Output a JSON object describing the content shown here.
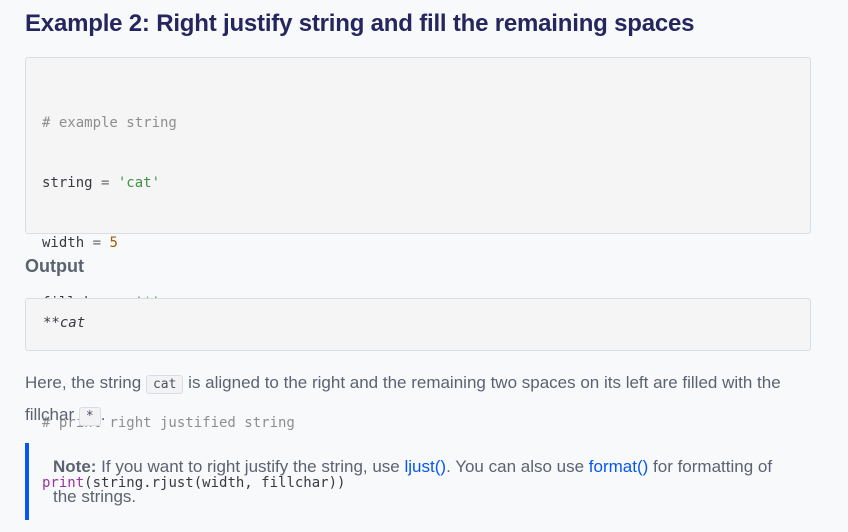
{
  "heading": "Example 2: Right justify string and fill the remaining spaces",
  "code": {
    "line1": "# example string",
    "line2_var": "string",
    "line2_op": " = ",
    "line2_val": "'cat'",
    "line3_var": "width",
    "line3_op": " = ",
    "line3_val": "5",
    "line4_var": "fillchar",
    "line4_op": " = ",
    "line4_val": "'*'",
    "line6": "# print right justified string",
    "line7_func": "print",
    "line7_rest": "(string.rjust(width, fillchar))"
  },
  "output": {
    "heading": "Output",
    "text": "**cat"
  },
  "paragraph": {
    "part1": "Here, the string ",
    "code1": "cat",
    "part2": " is aligned to the right and the remaining two spaces on its left are filled with the fillchar ",
    "code2": "*",
    "part3": "."
  },
  "note": {
    "label": "Note:",
    "part1": " If you want to right justify the string, use ",
    "link1": "ljust()",
    "part2": ". You can also use ",
    "link2": "format()",
    "part3": " for formatting of the strings."
  },
  "colors": {
    "heading": "#25265e",
    "accent": "#0556f3",
    "body_text": "#5c6270",
    "code_bg": "#f5f5f5"
  }
}
